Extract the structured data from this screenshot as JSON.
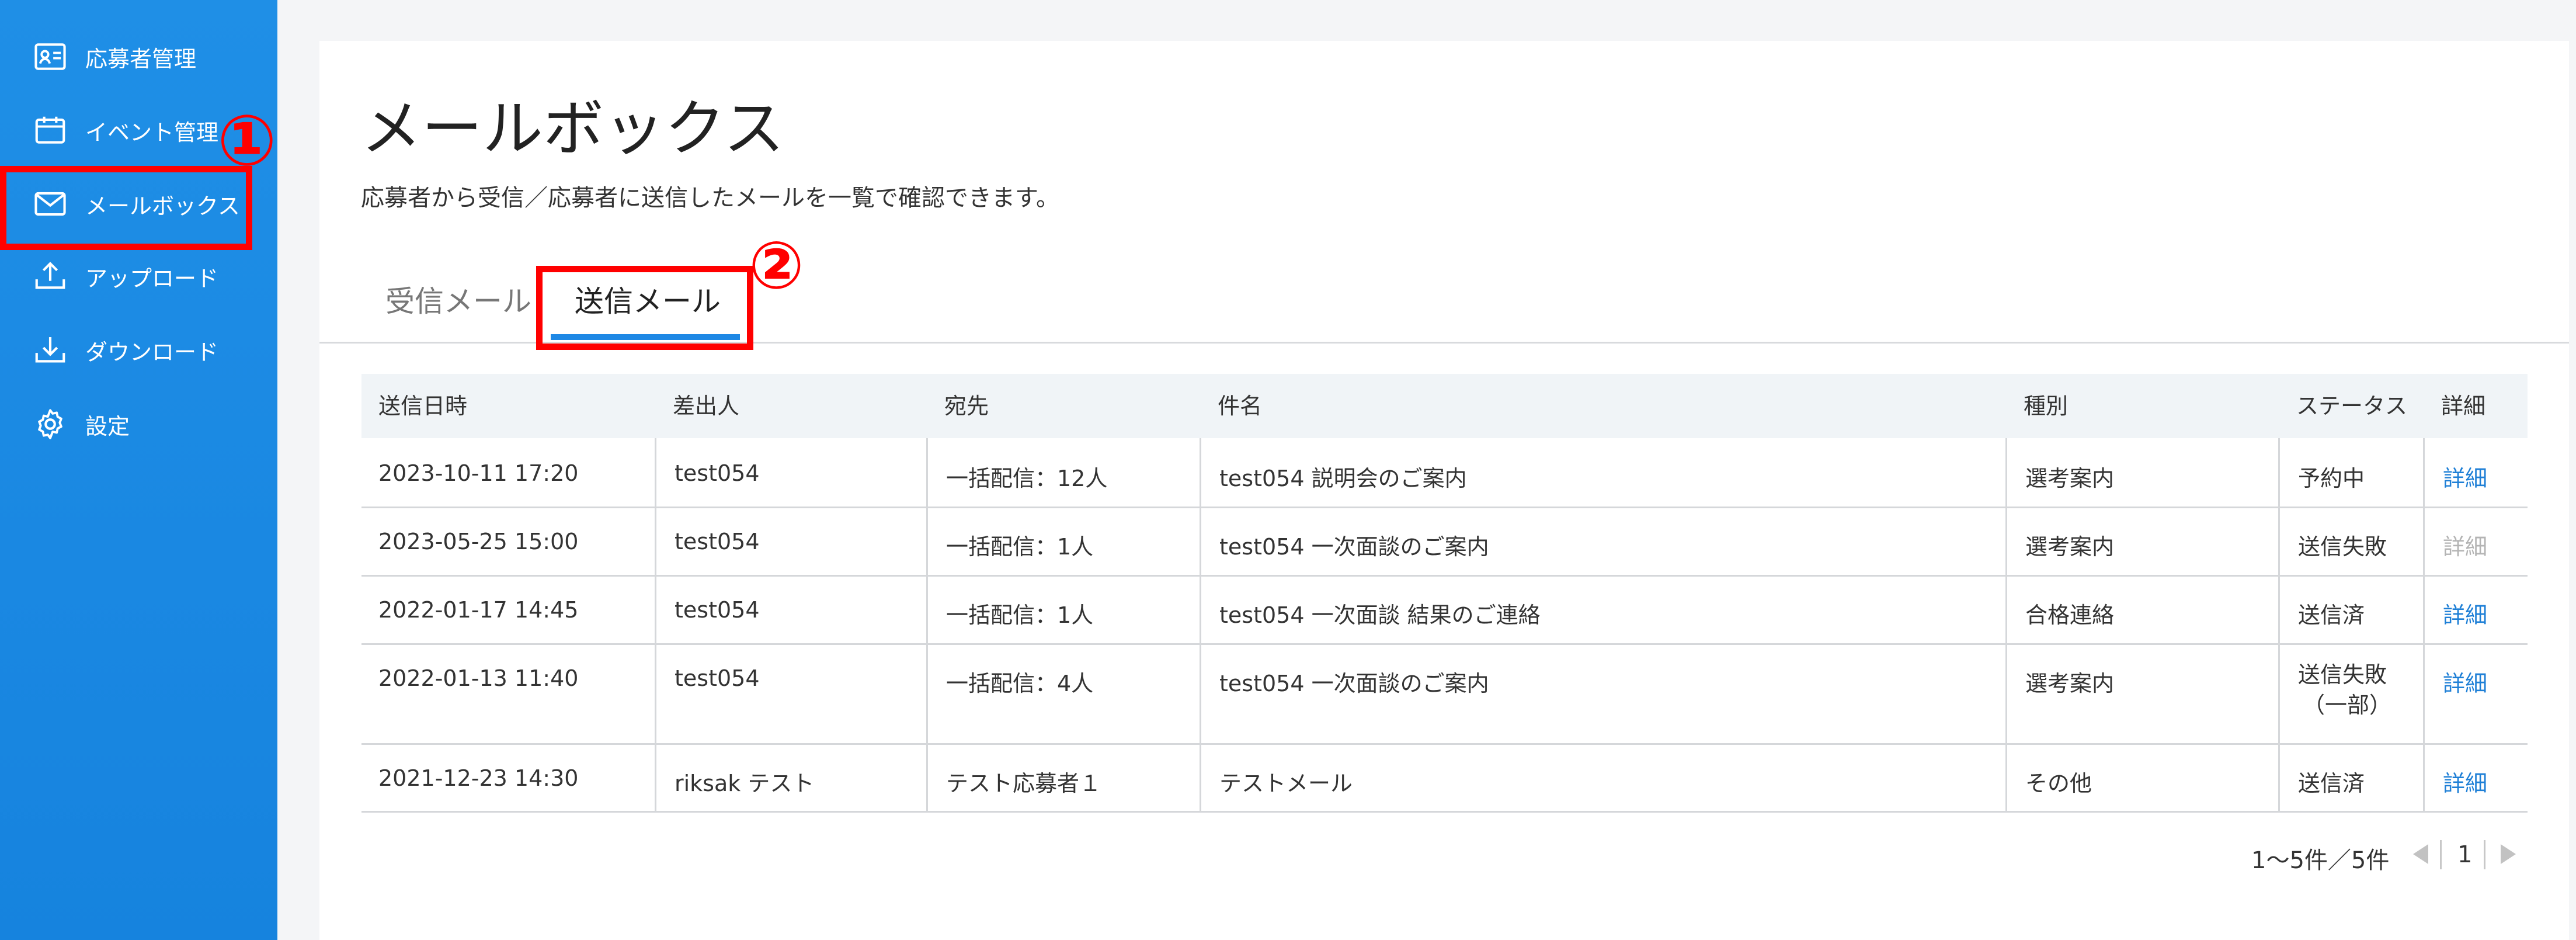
{
  "sidebar": {
    "items": [
      {
        "label": "応募者管理",
        "icon": "contact-card-icon"
      },
      {
        "label": "イベント管理",
        "icon": "calendar-icon"
      },
      {
        "label": "メールボックス",
        "icon": "mail-icon"
      },
      {
        "label": "アップロード",
        "icon": "upload-icon"
      },
      {
        "label": "ダウンロード",
        "icon": "download-icon"
      },
      {
        "label": "設定",
        "icon": "gear-icon"
      }
    ]
  },
  "annotations": {
    "marker1": "①",
    "marker2": "②",
    "color": "#ff0000"
  },
  "page": {
    "title": "メールボックス",
    "description": "応募者から受信／応募者に送信したメールを一覧で確認できます。"
  },
  "tabs": [
    {
      "label": "受信メール",
      "active": false
    },
    {
      "label": "送信メール",
      "active": true
    }
  ],
  "table": {
    "headers": [
      "送信日時",
      "差出人",
      "宛先",
      "件名",
      "種別",
      "ステータス",
      "詳細"
    ],
    "rows": [
      {
        "datetime": "2023-10-11 17:20",
        "sender": "test054",
        "recipient": "一括配信：12人",
        "subject": "test054 説明会のご案内",
        "type": "選考案内",
        "status": "予約中",
        "detail": "詳細",
        "detail_enabled": true
      },
      {
        "datetime": "2023-05-25 15:00",
        "sender": "test054",
        "recipient": "一括配信：1人",
        "subject": "test054 一次面談のご案内",
        "type": "選考案内",
        "status": "送信失敗",
        "detail": "詳細",
        "detail_enabled": false
      },
      {
        "datetime": "2022-01-17 14:45",
        "sender": "test054",
        "recipient": "一括配信：1人",
        "subject": "test054 一次面談 結果のご連絡",
        "type": "合格連絡",
        "status": "送信済",
        "detail": "詳細",
        "detail_enabled": true
      },
      {
        "datetime": "2022-01-13 11:40",
        "sender": "test054",
        "recipient": "一括配信：4人",
        "subject": "test054 一次面談のご案内",
        "type": "選考案内",
        "status": "送信失敗",
        "status_sub": "（一部）",
        "detail": "詳細",
        "detail_enabled": true
      },
      {
        "datetime": "2021-12-23 14:30",
        "sender": "riksak テスト",
        "recipient": "テスト応募者１",
        "subject": "テストメール",
        "type": "その他",
        "status": "送信済",
        "detail": "詳細",
        "detail_enabled": true
      }
    ]
  },
  "pagination": {
    "summary": "1～5件／5件",
    "current_page": "1"
  },
  "colors": {
    "sidebar": "#1a88e2",
    "accent": "#1e88e5",
    "link": "#1e7fd6",
    "highlight": "#ff0000"
  }
}
